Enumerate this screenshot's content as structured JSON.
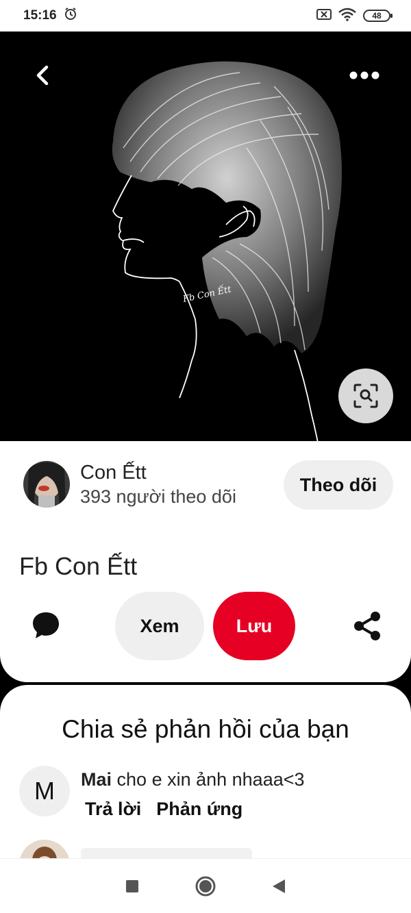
{
  "status_bar": {
    "time": "15:16",
    "battery": "48",
    "icons": [
      "alarm-icon",
      "no-sim-icon",
      "wifi-icon",
      "battery-icon"
    ]
  },
  "pin": {
    "image_watermark": "Fb Con Ếtt",
    "top_icons": [
      "back-arrow-icon",
      "more-options-icon"
    ],
    "lens_icon": "visual-search-icon"
  },
  "creator": {
    "name": "Con Ếtt",
    "followers": "393 người theo dõi",
    "follow_label": "Theo dõi"
  },
  "pin_title": "Fb Con Ếtt",
  "actions": {
    "view_label": "Xem",
    "save_label": "Lưu",
    "save_color": "#e60023",
    "icons": [
      "comment-icon",
      "share-icon"
    ]
  },
  "comments": {
    "title": "Chia sẻ phản hồi của bạn",
    "items": [
      {
        "avatar_letter": "M",
        "author": "Mai",
        "text": "cho e xin ảnh nhaaa<3",
        "reply_label": "Trả lời",
        "react_label": "Phản ứng"
      }
    ]
  },
  "nav_bar": {
    "icons": [
      "recent-apps-icon",
      "home-icon",
      "back-icon"
    ]
  }
}
